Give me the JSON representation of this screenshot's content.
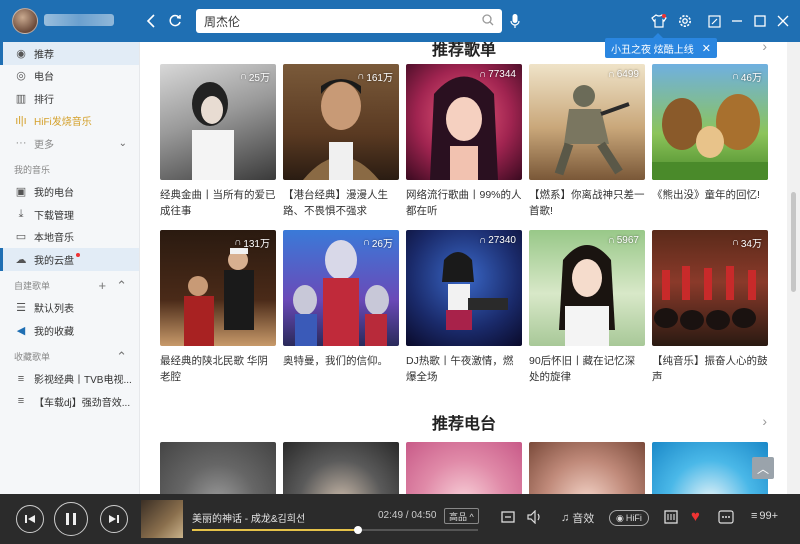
{
  "header": {
    "search_value": "周杰伦",
    "tooltip_text": "小丑之夜 炫酷上线"
  },
  "sidebar": {
    "items": [
      {
        "label": "推荐",
        "icon": "disc-icon"
      },
      {
        "label": "电台",
        "icon": "radio-icon"
      },
      {
        "label": "排行",
        "icon": "chart-icon"
      },
      {
        "label": "HiFi发烧音乐",
        "icon": "waveform-icon"
      },
      {
        "label": "更多",
        "icon": "more-icon"
      }
    ],
    "my_music_header": "我的音乐",
    "my_music": [
      {
        "label": "我的电台",
        "icon": "radio-box-icon"
      },
      {
        "label": "下载管理",
        "icon": "download-icon"
      },
      {
        "label": "本地音乐",
        "icon": "monitor-icon"
      },
      {
        "label": "我的云盘",
        "icon": "cloud-icon"
      }
    ],
    "created_header": "自建歌单",
    "created": [
      {
        "label": "默认列表",
        "icon": "list-icon"
      },
      {
        "label": "我的收藏",
        "icon": "speaker-icon"
      }
    ],
    "collected_header": "收藏歌单",
    "collected": [
      {
        "label": "影视经典丨TVB电视...",
        "icon": "playlist-icon"
      },
      {
        "label": "【车载dj】强劲音效...",
        "icon": "playlist-icon"
      }
    ]
  },
  "content": {
    "playlists_title": "推荐歌单",
    "radio_title": "推荐电台",
    "playlists": [
      {
        "count": "25万",
        "caption": "经典金曲丨当所有的爱已成往事"
      },
      {
        "count": "161万",
        "caption": "【港台经典】漫漫人生路、不畏惧不强求"
      },
      {
        "count": "77344",
        "caption": "网络流行歌曲丨99%的人都在听"
      },
      {
        "count": "6499",
        "caption": "【燃系】你离战神只差一首歌!"
      },
      {
        "count": "46万",
        "caption": "《熊出没》童年的回忆!"
      },
      {
        "count": "131万",
        "caption": "最经典的陕北民歌 华阴老腔"
      },
      {
        "count": "26万",
        "caption": "奥特曼，我们的信仰。"
      },
      {
        "count": "27340",
        "caption": "DJ热歌丨午夜激情，燃爆全场"
      },
      {
        "count": "5967",
        "caption": "90后怀旧丨藏在记忆深处的旋律"
      },
      {
        "count": "34万",
        "caption": "【纯音乐】振奋人心的鼓声"
      }
    ]
  },
  "player": {
    "song": "美丽的神话 - 成龙&김희선",
    "time": "02:49 / 04:50",
    "quality": "高品 ^",
    "progress": 0.58,
    "effects_label": "音效",
    "hifi_label": "HiFi",
    "queue_count": "99+"
  }
}
